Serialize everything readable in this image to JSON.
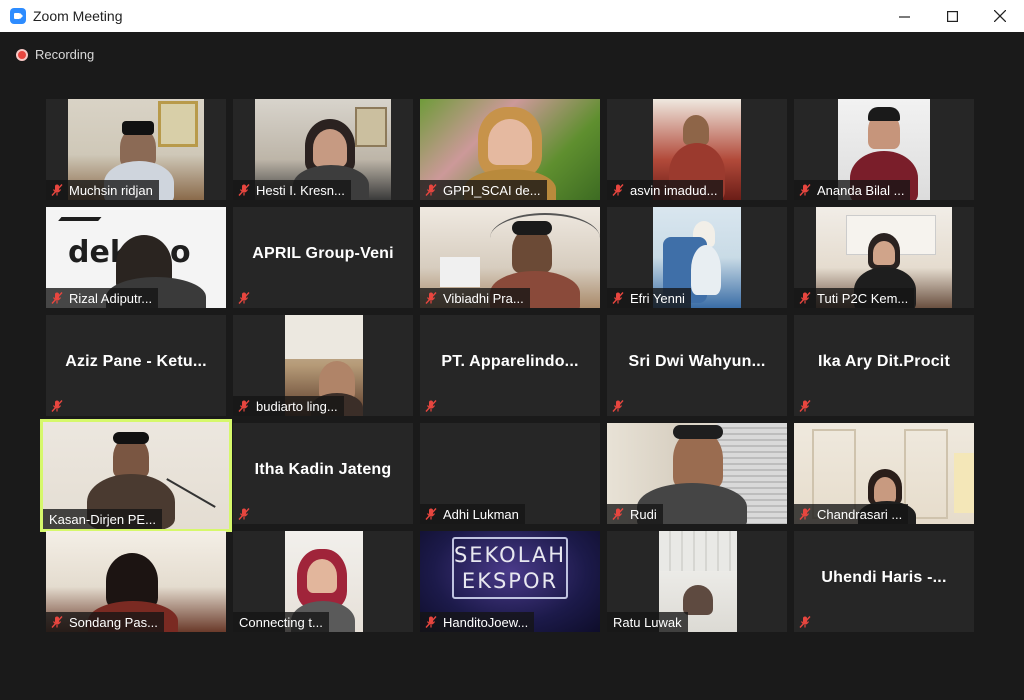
{
  "window": {
    "title": "Zoom Meeting",
    "controls": {
      "minimize": "—",
      "maximize": "☐",
      "close": "✕"
    }
  },
  "recording": {
    "label": "Recording"
  },
  "icons": {
    "muted_mic": "mic-muted-icon"
  },
  "accent": {
    "active_speaker": "#d6f86b",
    "recording": "#e8463f",
    "mute": "#e8463f"
  },
  "participants": [
    {
      "name": "Muchsin ridjan",
      "video": true,
      "muted": true
    },
    {
      "name": "Hesti I. Kresn...",
      "video": true,
      "muted": true
    },
    {
      "name": "GPPI_SCAI de...",
      "video": true,
      "muted": true
    },
    {
      "name": "asvin imadud...",
      "video": true,
      "muted": true
    },
    {
      "name": "Ananda Bilal ...",
      "video": true,
      "muted": true
    },
    {
      "name": "Rizal Adiputr...",
      "video": true,
      "muted": true
    },
    {
      "display": "APRIL Group-Veni",
      "video": false,
      "muted": true
    },
    {
      "name": "Vibiadhi Pra...",
      "video": true,
      "muted": true
    },
    {
      "name": "Efri Yenni",
      "video": true,
      "muted": true
    },
    {
      "name": "Tuti P2C Kem...",
      "video": true,
      "muted": true
    },
    {
      "display": "Aziz Pane - Ketu...",
      "video": false,
      "muted": true
    },
    {
      "name": "budiarto ling...",
      "video": true,
      "muted": true
    },
    {
      "display": "PT. Apparelindo...",
      "video": false,
      "muted": true
    },
    {
      "display": "Sri Dwi Wahyun...",
      "video": false,
      "muted": true
    },
    {
      "display": "Ika Ary Dit.Procit",
      "video": false,
      "muted": true
    },
    {
      "name": "Kasan-Dirjen PE...",
      "video": true,
      "muted": false,
      "active": true
    },
    {
      "display": "Itha Kadin Jateng",
      "video": false,
      "muted": true
    },
    {
      "name": "Adhi Lukman",
      "video": false,
      "muted": true
    },
    {
      "name": "Rudi",
      "video": true,
      "muted": true
    },
    {
      "name": "Chandrasari ...",
      "video": true,
      "muted": true
    },
    {
      "name": "Sondang Pas...",
      "video": true,
      "muted": true
    },
    {
      "name": "Connecting t...",
      "video": true,
      "muted": false
    },
    {
      "name": "HanditoJoew...",
      "video": true,
      "muted": true,
      "screen_text": [
        "SEKOLAH",
        "EKSPOR"
      ]
    },
    {
      "name": "Ratu Luwak",
      "video": true,
      "muted": false
    },
    {
      "display": "Uhendi Haris -...",
      "video": false,
      "muted": true
    }
  ]
}
